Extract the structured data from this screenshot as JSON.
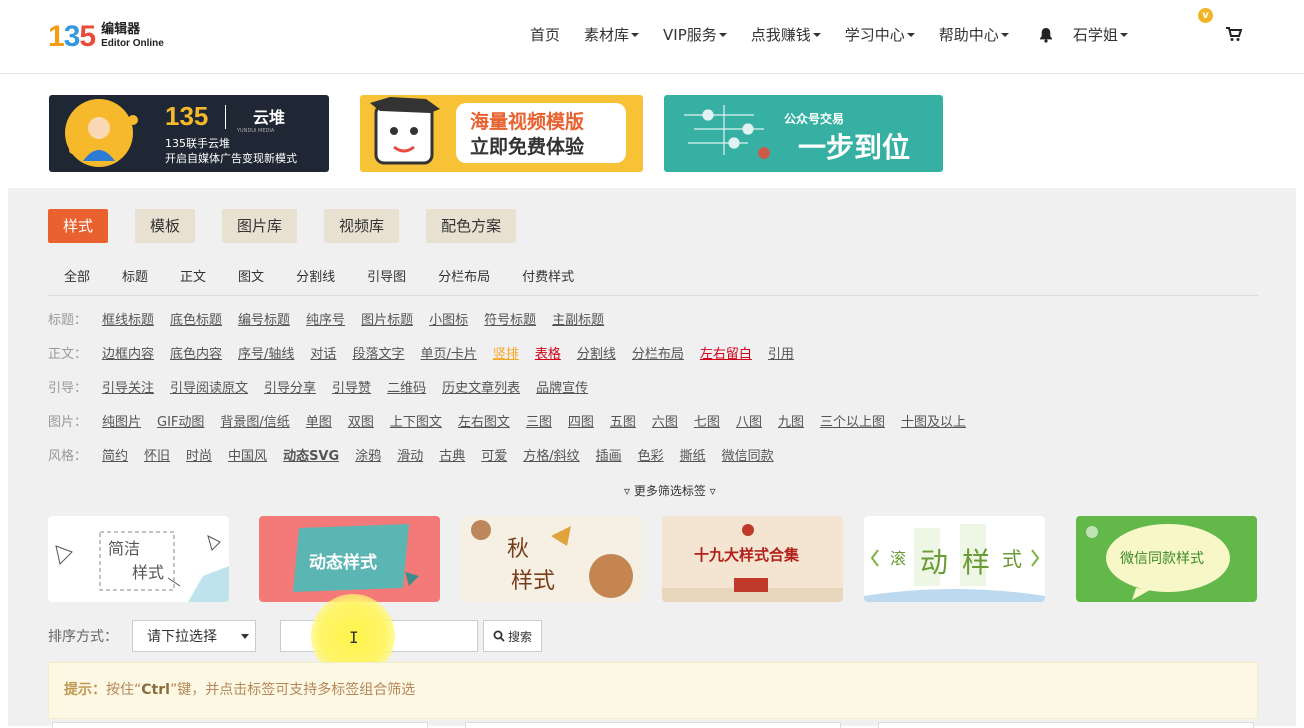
{
  "header": {
    "logo_mark": "135",
    "logo_cn": "编辑器",
    "logo_en": "Editor Online",
    "nav": [
      {
        "label": "首页",
        "dropdown": false
      },
      {
        "label": "素材库",
        "dropdown": true
      },
      {
        "label": "VIP服务",
        "dropdown": true
      },
      {
        "label": "点我赚钱",
        "dropdown": true
      },
      {
        "label": "学习中心",
        "dropdown": true
      },
      {
        "label": "帮助中心",
        "dropdown": true
      }
    ],
    "user": "石学姐",
    "vip_badge": "v"
  },
  "banners": [
    {
      "line1": "135联手云堆",
      "line2": "开启自媒体广告变现新模式",
      "brand": "135",
      "brand2": "云堆",
      "brand_sub": "YUNDUI MEDIA"
    },
    {
      "line1": "海量视频模版",
      "line2": "立即免费体验"
    },
    {
      "line1": "公众号交易",
      "line2": "一步到位"
    }
  ],
  "tabs": [
    "样式",
    "模板",
    "图片库",
    "视频库",
    "配色方案"
  ],
  "subcategories": [
    "全部",
    "标题",
    "正文",
    "图文",
    "分割线",
    "引导图",
    "分栏布局",
    "付费样式"
  ],
  "filters": [
    {
      "label": "标题：",
      "tags": [
        "框线标题",
        "底色标题",
        "编号标题",
        "纯序号",
        "图片标题",
        "小图标",
        "符号标题",
        "主副标题"
      ]
    },
    {
      "label": "正文：",
      "tags": [
        "边框内容",
        "底色内容",
        "序号/轴线",
        "对话",
        "段落文字",
        "单页/卡片",
        "竖排",
        "表格",
        "分割线",
        "分栏布局",
        "左右留白",
        "引用"
      ]
    },
    {
      "label": "引导：",
      "tags": [
        "引导关注",
        "引导阅读原文",
        "引导分享",
        "引导赞",
        "二维码",
        "历史文章列表",
        "品牌宣传"
      ]
    },
    {
      "label": "图片：",
      "tags": [
        "纯图片",
        "GIF动图",
        "背景图/信纸",
        "单图",
        "双图",
        "上下图文",
        "左右图文",
        "三图",
        "四图",
        "五图",
        "六图",
        "七图",
        "八图",
        "九图",
        "三个以上图",
        "十图及以上"
      ]
    },
    {
      "label": "风格：",
      "tags": [
        "简约",
        "怀旧",
        "时尚",
        "中国风",
        "动态SVG",
        "涂鸦",
        "滑动",
        "古典",
        "可爱",
        "方格/斜纹",
        "插画",
        "色彩",
        "撕纸",
        "微信同款"
      ]
    }
  ],
  "more_filters": "▿ 更多筛选标签 ▿",
  "feature_cards": [
    {
      "text1": "简洁",
      "text2": "样式",
      "bg": "#ffffff"
    },
    {
      "text1": "动态样式",
      "bg": "#f47a7a"
    },
    {
      "text1": "秋",
      "text2": "样式",
      "bg": "#f6efe4"
    },
    {
      "text1": "十九大样式合集",
      "bg": "#f3e5d2"
    },
    {
      "text1": "滚",
      "text2": "动",
      "text3": "样",
      "text4": "式",
      "bg": "#ffffff"
    },
    {
      "text1": "微信同款样式",
      "bg": "#62b94a"
    }
  ],
  "sort": {
    "label": "排序方式：",
    "select_value": "请下拉选择",
    "search_placeholder": "",
    "search_button": "搜索"
  },
  "tip": {
    "prefix": "提示：",
    "text_before": "按住“",
    "key": "Ctrl",
    "text_after": "”键，并点击标签可支持多标签组合筛选"
  },
  "colors": {
    "accent": "#e8612f",
    "tab_bg": "#e8e1d2",
    "tip_bg": "#fcf8e3"
  }
}
